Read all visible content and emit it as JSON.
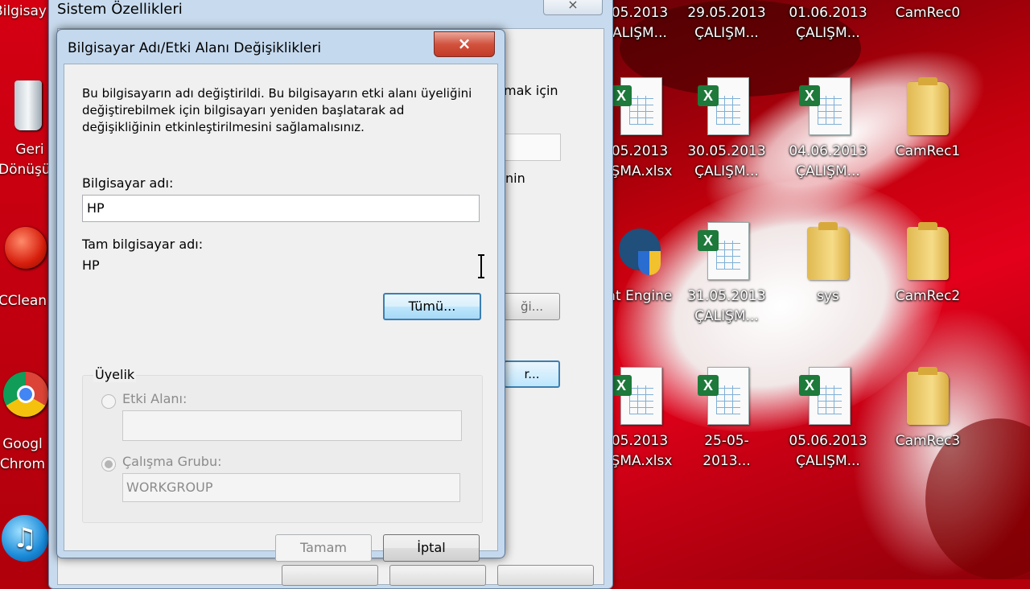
{
  "colors": {
    "desktop_red": "#c4000d",
    "dialog_frame": "#c5d9ee",
    "close_red": "#c33a26",
    "focus_blue": "#3c7fb1"
  },
  "left_edge_icons": [
    {
      "label": "Bilgisay",
      "icon": "computer-icon"
    },
    {
      "label": "Geri Dönüşü",
      "label_line1": "Geri",
      "label_line2": "Dönüşü",
      "icon": "recycle-bin-icon"
    },
    {
      "label": "CClean",
      "icon": "ccleaner-icon"
    },
    {
      "label_line1": "Googl",
      "label_line2": "Chrom",
      "icon": "chrome-icon"
    },
    {
      "label": "",
      "icon": "itunes-icon"
    }
  ],
  "desktop_icons": [
    {
      "id": "r1c1",
      "line1": "05.2013",
      "line2": "ALIŞM...",
      "type": "excel"
    },
    {
      "id": "r1c2",
      "line1": "29.05.2013",
      "line2": "ÇALIŞM...",
      "type": "excel"
    },
    {
      "id": "r1c3",
      "line1": "01.06.2013",
      "line2": "ÇALIŞM...",
      "type": "excel"
    },
    {
      "id": "r1c4",
      "line1": "CamRec0",
      "line2": "",
      "type": "folder"
    },
    {
      "id": "r2c1",
      "line1": "05.2013",
      "line2": "IŞMA.xlsx",
      "type": "excel"
    },
    {
      "id": "r2c2",
      "line1": "30.05.2013",
      "line2": "ÇALIŞM...",
      "type": "excel"
    },
    {
      "id": "r2c3",
      "line1": "04.06.2013",
      "line2": "ÇALIŞM...",
      "type": "excel"
    },
    {
      "id": "r2c4",
      "line1": "CamRec1",
      "line2": "",
      "type": "folder"
    },
    {
      "id": "r3c1",
      "line1": "at Engine",
      "line2": "",
      "type": "app"
    },
    {
      "id": "r3c2",
      "line1": "31.05.2013",
      "line2": "ÇALIŞM...",
      "type": "excel"
    },
    {
      "id": "r3c3",
      "line1": "sys",
      "line2": "",
      "type": "folder"
    },
    {
      "id": "r3c4",
      "line1": "CamRec2",
      "line2": "",
      "type": "folder"
    },
    {
      "id": "r4c1",
      "line1": "05.2013",
      "line2": "IŞMA.xlsx",
      "type": "excel"
    },
    {
      "id": "r4c2",
      "line1": "25-05-2013...",
      "line2": "",
      "type": "excel"
    },
    {
      "id": "r4c3",
      "line1": "05.06.2013",
      "line2": "ÇALIŞM...",
      "type": "excel"
    },
    {
      "id": "r4c4",
      "line1": "CamRec3",
      "line2": "",
      "type": "folder"
    }
  ],
  "sysprops": {
    "title": "Sistem Özellikleri",
    "close": "×",
    "fragment_1": "mak için",
    "fragment_2": "nin",
    "fragment_3": "ği...",
    "fragment_4": "r..."
  },
  "dialog": {
    "title": "Bilgisayar Adı/Etki Alanı Değişiklikleri",
    "close": "×",
    "info_line1": "Bu bilgisayarın adı değiştirildi.  Bu bilgisayarın etki alanı üyeliğini",
    "info_line2": "değiştirebilmek için bilgisayarı yeniden başlatarak ad",
    "info_line3": "değişikliğinin etkinleştirilmesini sağlamalısınız.",
    "computer_name_label": "Bilgisayar adı:",
    "computer_name_value": "HP",
    "full_name_label": "Tam bilgisayar adı:",
    "full_name_value": "HP",
    "more_button": "Tümü...",
    "membership_label": "Üyelik",
    "domain_label": "Etki Alanı:",
    "domain_value": "",
    "workgroup_label": "Çalışma Grubu:",
    "workgroup_value": "WORKGROUP",
    "ok_button": "Tamam",
    "cancel_button": "İptal"
  }
}
